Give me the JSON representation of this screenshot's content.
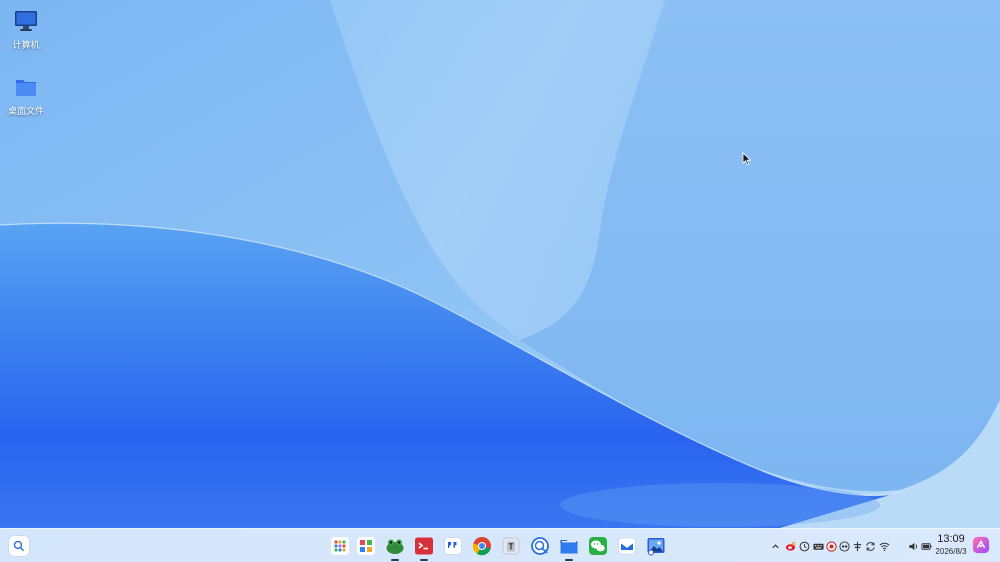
{
  "desktop": {
    "icons": [
      {
        "label": "计算机",
        "icon": "computer-icon"
      },
      {
        "label": "桌面文件",
        "icon": "folder-icon"
      }
    ]
  },
  "taskbar": {
    "search_icon": "search-icon",
    "apps": [
      {
        "icon": "app-launcher-icon",
        "running": false
      },
      {
        "icon": "multitasking-view-icon",
        "running": false
      },
      {
        "icon": "frog-app-icon",
        "running": true
      },
      {
        "icon": "terminal-icon",
        "running": true
      },
      {
        "icon": "quote-app-icon",
        "running": false
      },
      {
        "icon": "chrome-icon",
        "running": false
      },
      {
        "icon": "text-editor-icon",
        "running": false
      },
      {
        "icon": "screen-recorder-icon",
        "running": false
      },
      {
        "icon": "file-manager-icon",
        "running": true
      },
      {
        "icon": "wechat-icon",
        "running": false
      },
      {
        "icon": "mail-icon",
        "running": false
      },
      {
        "icon": "image-viewer-icon",
        "running": false
      }
    ],
    "tray": {
      "icons": [
        "chevron-up-icon",
        "weibo-icon",
        "clock-icon",
        "keyboard-icon",
        "antivirus-icon",
        "vpn-icon",
        "pin-icon",
        "sync-icon",
        "wifi-icon",
        "volume-icon",
        "battery-icon"
      ],
      "time": "13:09",
      "date": "2026/8/3",
      "notification_icon": "notification-center-icon"
    }
  },
  "colors": {
    "wallpaper_light": "#a9d2f7",
    "wallpaper_deep": "#1f5ef0",
    "taskbar_bg": "#deeafc"
  }
}
